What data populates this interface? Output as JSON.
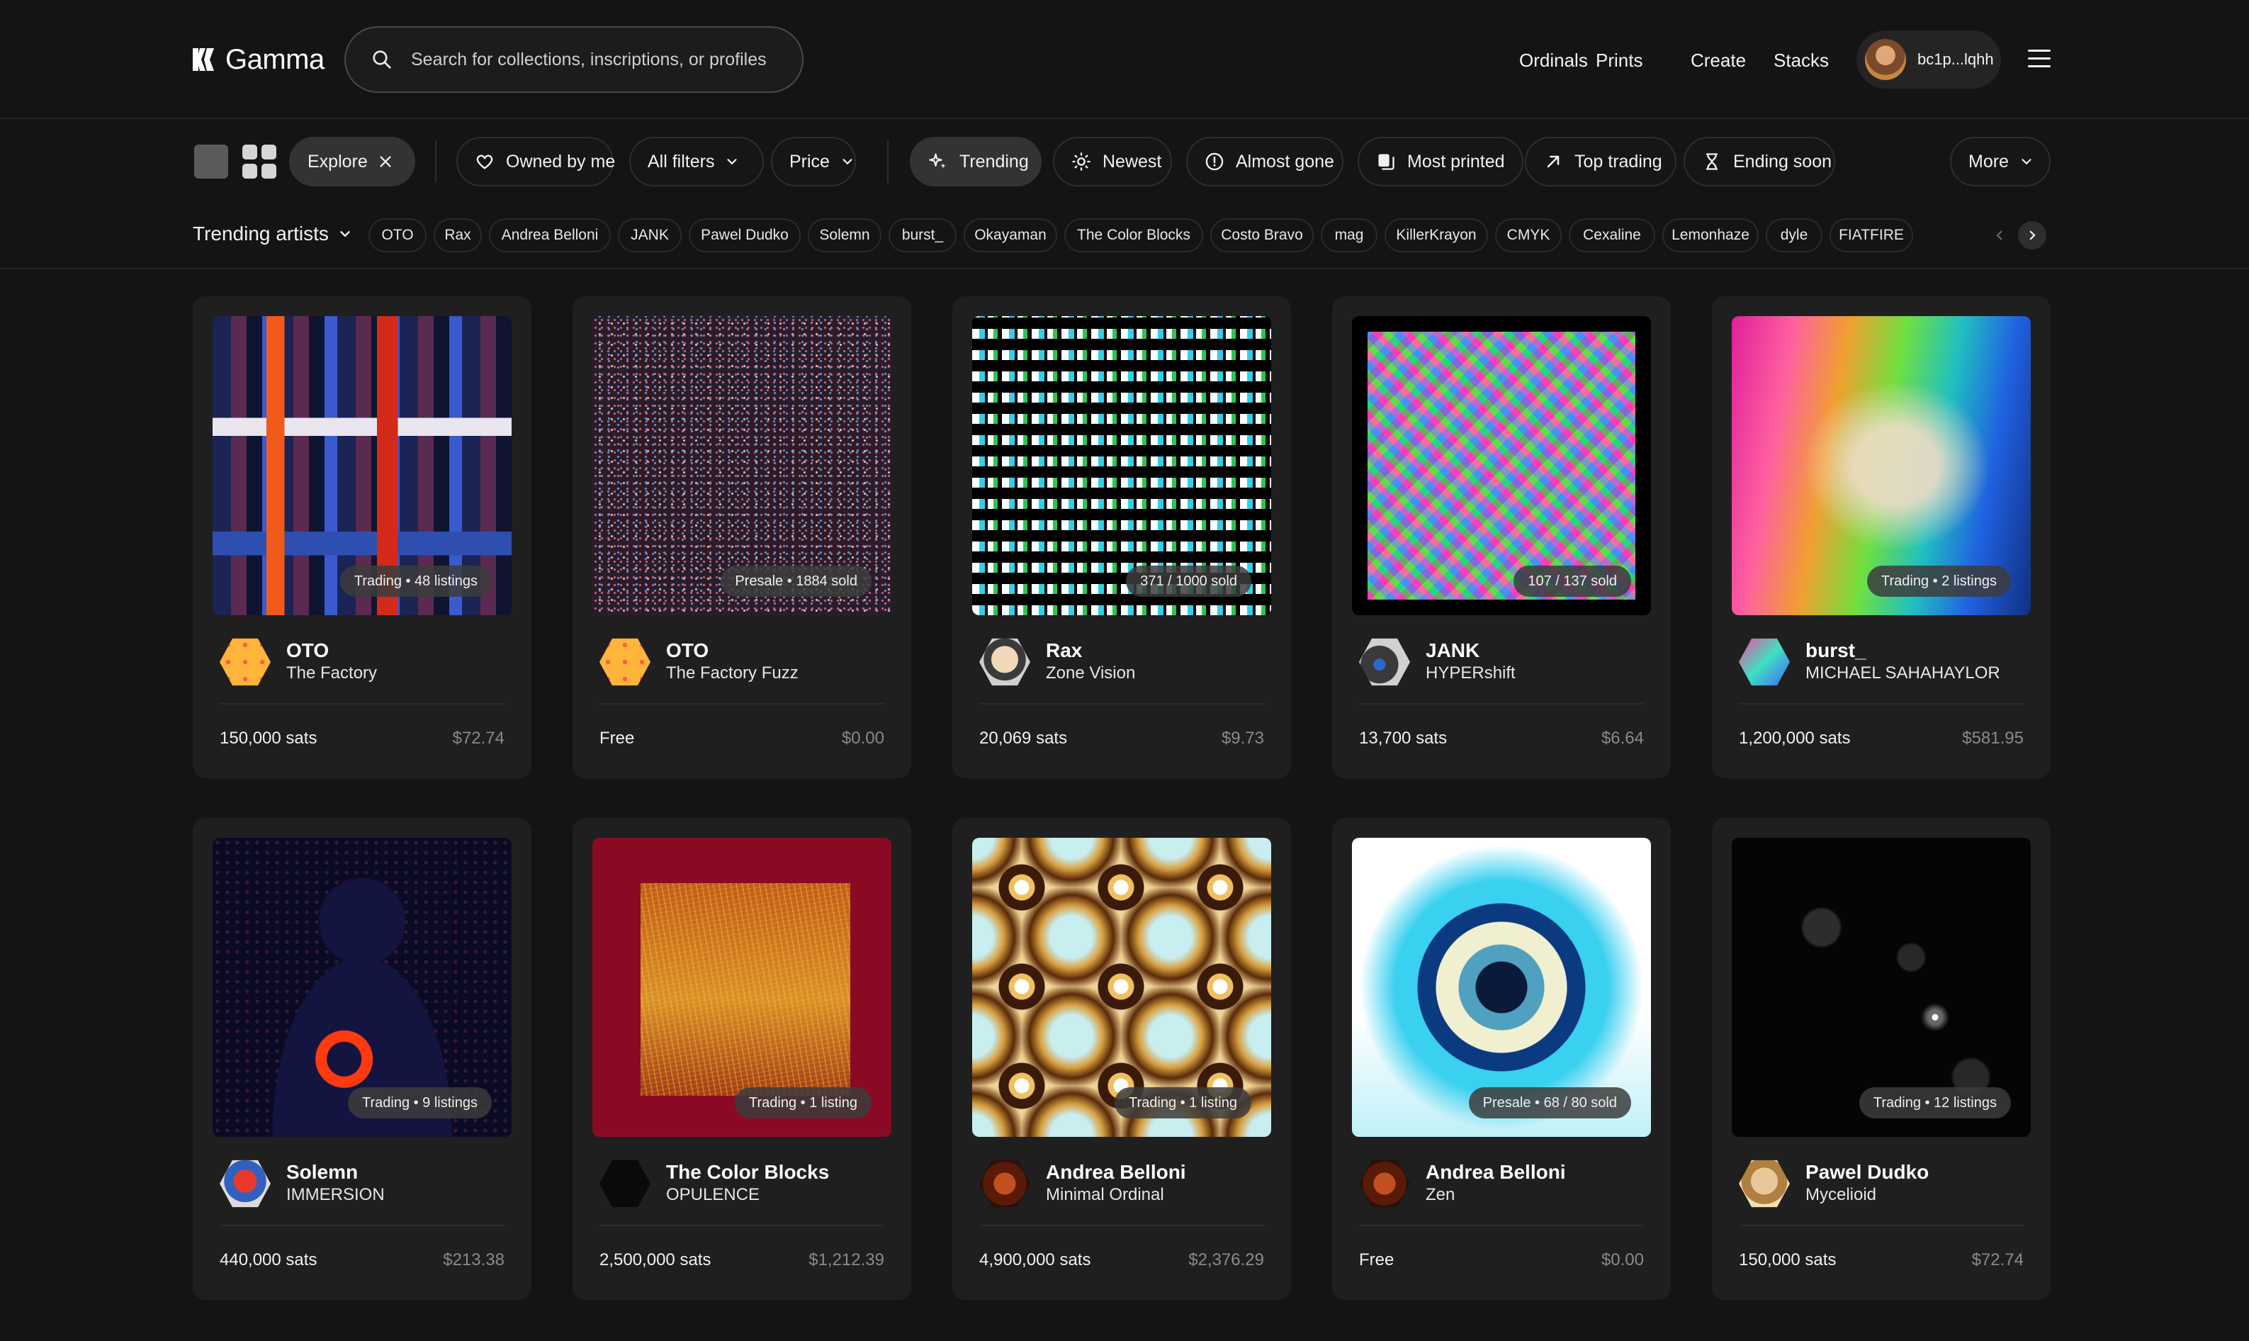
{
  "app": {
    "logo_text": "Gamma"
  },
  "search": {
    "placeholder": "Search for collections, inscriptions, or profiles"
  },
  "nav": {
    "ordinals": "Ordinals",
    "prints": "Prints",
    "create": "Create",
    "stacks": "Stacks"
  },
  "user": {
    "handle": "bc1p...lqhh"
  },
  "filters": {
    "explore": "Explore",
    "owned_by_me": "Owned by me",
    "all_filters": "All filters",
    "price": "Price",
    "trending": "Trending",
    "newest": "Newest",
    "almost_gone": "Almost gone",
    "most_printed": "Most printed",
    "top_trading": "Top trading",
    "ending_soon": "Ending soon",
    "more": "More"
  },
  "trending_artists": {
    "label": "Trending artists",
    "items": [
      "OTO",
      "Rax",
      "Andrea Belloni",
      "JANK",
      "Pawel Dudko",
      "Solemn",
      "burst_",
      "Okayaman",
      "The Color Blocks",
      "Costo Bravo",
      "mag",
      "KillerKrayon",
      "CMYK",
      "Cexaline",
      "Lemonhaze",
      "dyle",
      "FIATFIRE"
    ]
  },
  "cards": [
    {
      "artist": "OTO",
      "title": "The Factory",
      "badge": "Trading • 48 listings",
      "price": "150,000 sats",
      "usd": "$72.74"
    },
    {
      "artist": "OTO",
      "title": "The Factory Fuzz",
      "badge": "Presale • 1884 sold",
      "price": "Free",
      "usd": "$0.00"
    },
    {
      "artist": "Rax",
      "title": "Zone Vision",
      "badge": "371 / 1000 sold",
      "price": "20,069 sats",
      "usd": "$9.73"
    },
    {
      "artist": "JANK",
      "title": "HYPERshift",
      "badge": "107 / 137 sold",
      "price": "13,700 sats",
      "usd": "$6.64"
    },
    {
      "artist": "burst_",
      "title": "MICHAEL SAHAHAYLOR",
      "badge": "Trading • 2 listings",
      "price": "1,200,000 sats",
      "usd": "$581.95"
    },
    {
      "artist": "Solemn",
      "title": "IMMERSION",
      "badge": "Trading • 9 listings",
      "price": "440,000 sats",
      "usd": "$213.38"
    },
    {
      "artist": "The Color Blocks",
      "title": "OPULENCE",
      "badge": "Trading • 1 listing",
      "price": "2,500,000 sats",
      "usd": "$1,212.39"
    },
    {
      "artist": "Andrea Belloni",
      "title": "Minimal Ordinal",
      "badge": "Trading • 1 listing",
      "price": "4,900,000 sats",
      "usd": "$2,376.29"
    },
    {
      "artist": "Andrea Belloni",
      "title": "Zen",
      "badge": "Presale • 68 / 80 sold",
      "price": "Free",
      "usd": "$0.00"
    },
    {
      "artist": "Pawel Dudko",
      "title": "Mycelioid",
      "badge": "Trading • 12 listings",
      "price": "150,000 sats",
      "usd": "$72.74"
    }
  ]
}
